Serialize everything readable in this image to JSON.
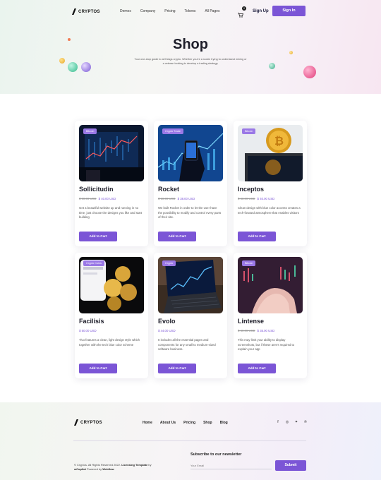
{
  "nav": {
    "logo": "CRYPTOS",
    "links": [
      "Demos",
      "Company",
      "Pricing",
      "Tokens",
      "All Pages"
    ],
    "cart_count": "0",
    "signup": "Sign Up",
    "signin": "Sign In"
  },
  "hero": {
    "title": "Shop",
    "subtitle": "Your one-stop guide to all things crypto. Whether you're a rookie trying to understand mining or a veteran looking to develop a trading strategy."
  },
  "products": [
    {
      "tag": "Bitcoin",
      "title": "Sollicitudin",
      "old_price": "$ 80.00 USD",
      "price": "$ 40.00 USD",
      "desc": "Get a beautiful website up and running in no time, just choose the designs you like and start building",
      "button": "Add to Cart"
    },
    {
      "tag": "Crypto Trade",
      "title": "Rocket",
      "old_price": "$ 50.00 USD",
      "price": "$ 38.00 USD",
      "desc": "We built Rocket in order to let the user have the possibility to modify and control every parts of their site.",
      "button": "Add to Cart"
    },
    {
      "tag": "Bitcoin",
      "title": "Inceptos",
      "old_price": "$ 48.00 USD",
      "price": "$ 40.00 USD",
      "desc": "Clean design with blue color accents creates a tech-forward atmosphere that enables visitors",
      "button": "Add to Cart"
    },
    {
      "tag": "Crypto Coins",
      "title": "Facilisis",
      "old_price": "",
      "price": "$ 50.00 USD",
      "desc": "Tivo features a clean, light design style which together with the tech blue color scheme",
      "button": "Add to Cart"
    },
    {
      "tag": "Crypto",
      "title": "Evolo",
      "old_price": "",
      "price": "$ 44.00 USD",
      "desc": "It includes all the essential pages and components for any small to medium-sized software business.",
      "button": "Add to Cart"
    },
    {
      "tag": "Bitcoin",
      "title": "Lintense",
      "old_price": "$ 40.00 USD",
      "price": "$ 35.00 USD",
      "desc": "This may limit your ability to display screenshots, but if these aren't required to explain your app",
      "button": "Add to Cart"
    }
  ],
  "footer": {
    "logo": "CRYPTOS",
    "links": [
      "Home",
      "About Us",
      "Pricing",
      "Shop",
      "Blog"
    ],
    "social_icons": [
      "facebook-icon",
      "instagram-icon",
      "twitter-icon",
      "pinterest-icon"
    ],
    "copyright_prefix": "© Cryptos. All Rights Reserved 2022.",
    "licensing": "Licensing",
    "template_by": "Template",
    "by_word": "by",
    "author": "wCopilot",
    "powered_by": "Powered by",
    "platform": "Webflow",
    "newsletter_title": "Subscribe to our newsletter",
    "email_placeholder": "Your Email",
    "submit": "Submit"
  }
}
